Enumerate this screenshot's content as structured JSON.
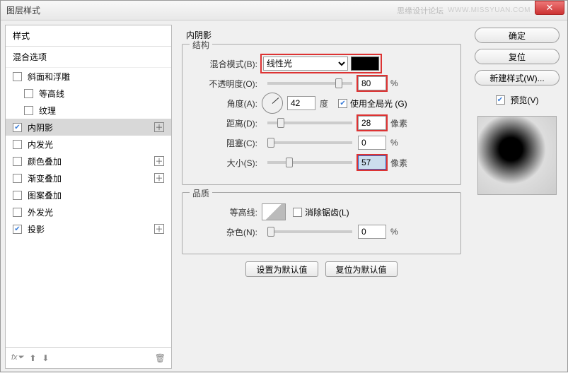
{
  "title": "图层样式",
  "watermark1": "思缘设计论坛",
  "watermark2": "WWW.MISSYUAN.COM",
  "left": {
    "styles_header": "样式",
    "blend_header": "混合选项",
    "items": [
      {
        "label": "斜面和浮雕",
        "checked": false,
        "hasPlus": false,
        "indent": false
      },
      {
        "label": "等高线",
        "checked": false,
        "hasPlus": false,
        "indent": true
      },
      {
        "label": "纹理",
        "checked": false,
        "hasPlus": false,
        "indent": true
      },
      {
        "label": "内阴影",
        "checked": true,
        "hasPlus": true,
        "indent": false,
        "selected": true
      },
      {
        "label": "内发光",
        "checked": false,
        "hasPlus": false,
        "indent": false
      },
      {
        "label": "颜色叠加",
        "checked": false,
        "hasPlus": true,
        "indent": false
      },
      {
        "label": "渐变叠加",
        "checked": false,
        "hasPlus": true,
        "indent": false
      },
      {
        "label": "图案叠加",
        "checked": false,
        "hasPlus": false,
        "indent": false
      },
      {
        "label": "外发光",
        "checked": false,
        "hasPlus": false,
        "indent": false
      },
      {
        "label": "投影",
        "checked": true,
        "hasPlus": true,
        "indent": false
      }
    ]
  },
  "center": {
    "panel_title": "内阴影",
    "structure_legend": "结构",
    "blend_mode_label": "混合模式(B):",
    "blend_mode_value": "线性光",
    "opacity_label": "不透明度(O):",
    "opacity_value": "80",
    "pct": "%",
    "angle_label": "角度(A):",
    "angle_value": "42",
    "degree": "度",
    "global_light": "使用全局光 (G)",
    "distance_label": "距离(D):",
    "distance_value": "28",
    "px": "像素",
    "choke_label": "阻塞(C):",
    "choke_value": "0",
    "size_label": "大小(S):",
    "size_value": "57",
    "quality_legend": "品质",
    "contour_label": "等高线:",
    "antialias": "消除锯齿(L)",
    "noise_label": "杂色(N):",
    "noise_value": "0",
    "set_default": "设置为默认值",
    "reset_default": "复位为默认值"
  },
  "right": {
    "ok": "确定",
    "cancel": "复位",
    "new_style": "新建样式(W)...",
    "preview": "预览(V)"
  }
}
